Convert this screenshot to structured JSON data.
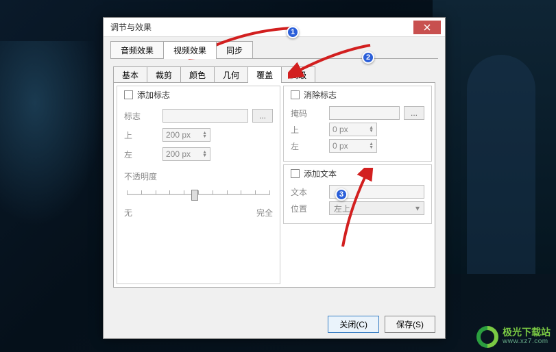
{
  "dialog": {
    "title": "调节与效果"
  },
  "main_tabs": {
    "audio": "音频效果",
    "video": "视频效果",
    "sync": "同步"
  },
  "sub_tabs": {
    "basic": "基本",
    "crop": "裁剪",
    "color": "颜色",
    "geometry": "几何",
    "overlay": "覆盖",
    "advanced": "高级"
  },
  "add_logo": {
    "title": "添加标志",
    "logo_label": "标志",
    "browse": "...",
    "top_label": "上",
    "top_value": "200 px",
    "left_label": "左",
    "left_value": "200 px",
    "opacity_label": "不透明度",
    "slider_min": "无",
    "slider_max": "完全"
  },
  "remove_logo": {
    "title": "消除标志",
    "mask_label": "掩码",
    "browse": "...",
    "top_label": "上",
    "top_value": "0 px",
    "left_label": "左",
    "left_value": "0 px"
  },
  "add_text": {
    "title": "添加文本",
    "text_label": "文本",
    "position_label": "位置",
    "position_value": "左上"
  },
  "footer": {
    "close": "关闭(C)",
    "save": "保存(S)"
  },
  "annotations": {
    "b1": "1",
    "b2": "2",
    "b3": "3"
  },
  "watermark": {
    "cn": "极光下载站",
    "en": "www.xz7.com"
  }
}
